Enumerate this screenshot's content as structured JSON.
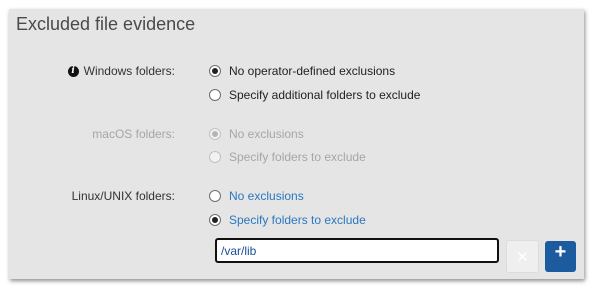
{
  "panel": {
    "title": "Excluded file evidence"
  },
  "windows": {
    "label": "Windows folders:",
    "info_icon_glyph": "i",
    "options": [
      {
        "label": "No operator-defined exclusions",
        "checked": true
      },
      {
        "label": "Specify additional folders to exclude",
        "checked": false
      }
    ]
  },
  "macos": {
    "label": "macOS folders:",
    "disabled": true,
    "options": [
      {
        "label": "No exclusions",
        "checked": true
      },
      {
        "label": "Specify folders to exclude",
        "checked": false
      }
    ]
  },
  "linux": {
    "label": "Linux/UNIX folders:",
    "options": [
      {
        "label": "No exclusions",
        "checked": false
      },
      {
        "label": "Specify folders to exclude",
        "checked": true
      }
    ],
    "folder_input": {
      "value": "/var/lib"
    },
    "remove_button_glyph": "✕",
    "add_button_glyph": "+"
  },
  "colors": {
    "link_blue": "#2a77c0",
    "add_button": "#1d5b9f",
    "panel_bg": "#e5e5e5"
  }
}
